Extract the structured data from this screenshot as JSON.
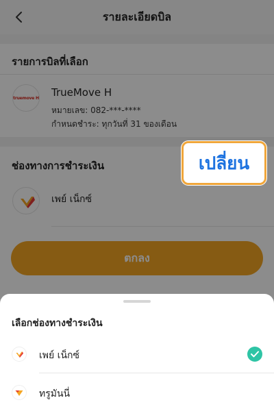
{
  "header": {
    "title": "รายละเอียดบิล"
  },
  "bill_section": {
    "title": "รายการบิลที่เลือก",
    "provider": "TrueMove H",
    "logo_text": "truemove H",
    "number_line": "หมายเลข: 082-***-****",
    "due_line": "กำหนดชำระ: ทุกวันที่ 31 ของเดือน"
  },
  "payment_section": {
    "title": "ช่องทางการชำระเงิน",
    "selected_method": "เพย์ เน็กซ์",
    "change_label": "เปลี่ยน"
  },
  "confirm_button": {
    "label": "ตกลง"
  },
  "sheet": {
    "title": "เลือกช่องทางชำระเงิน",
    "options": [
      {
        "label": "เพย์ เน็กซ์",
        "selected": true
      },
      {
        "label": "ทรูมันนี่",
        "selected": false
      }
    ]
  },
  "colors": {
    "accent": "#f5a623",
    "highlight_border": "#f0a63a",
    "change_text": "#1e73e0",
    "check": "#2ec4a5",
    "overlay": "rgba(0,0,0,0.45)"
  }
}
